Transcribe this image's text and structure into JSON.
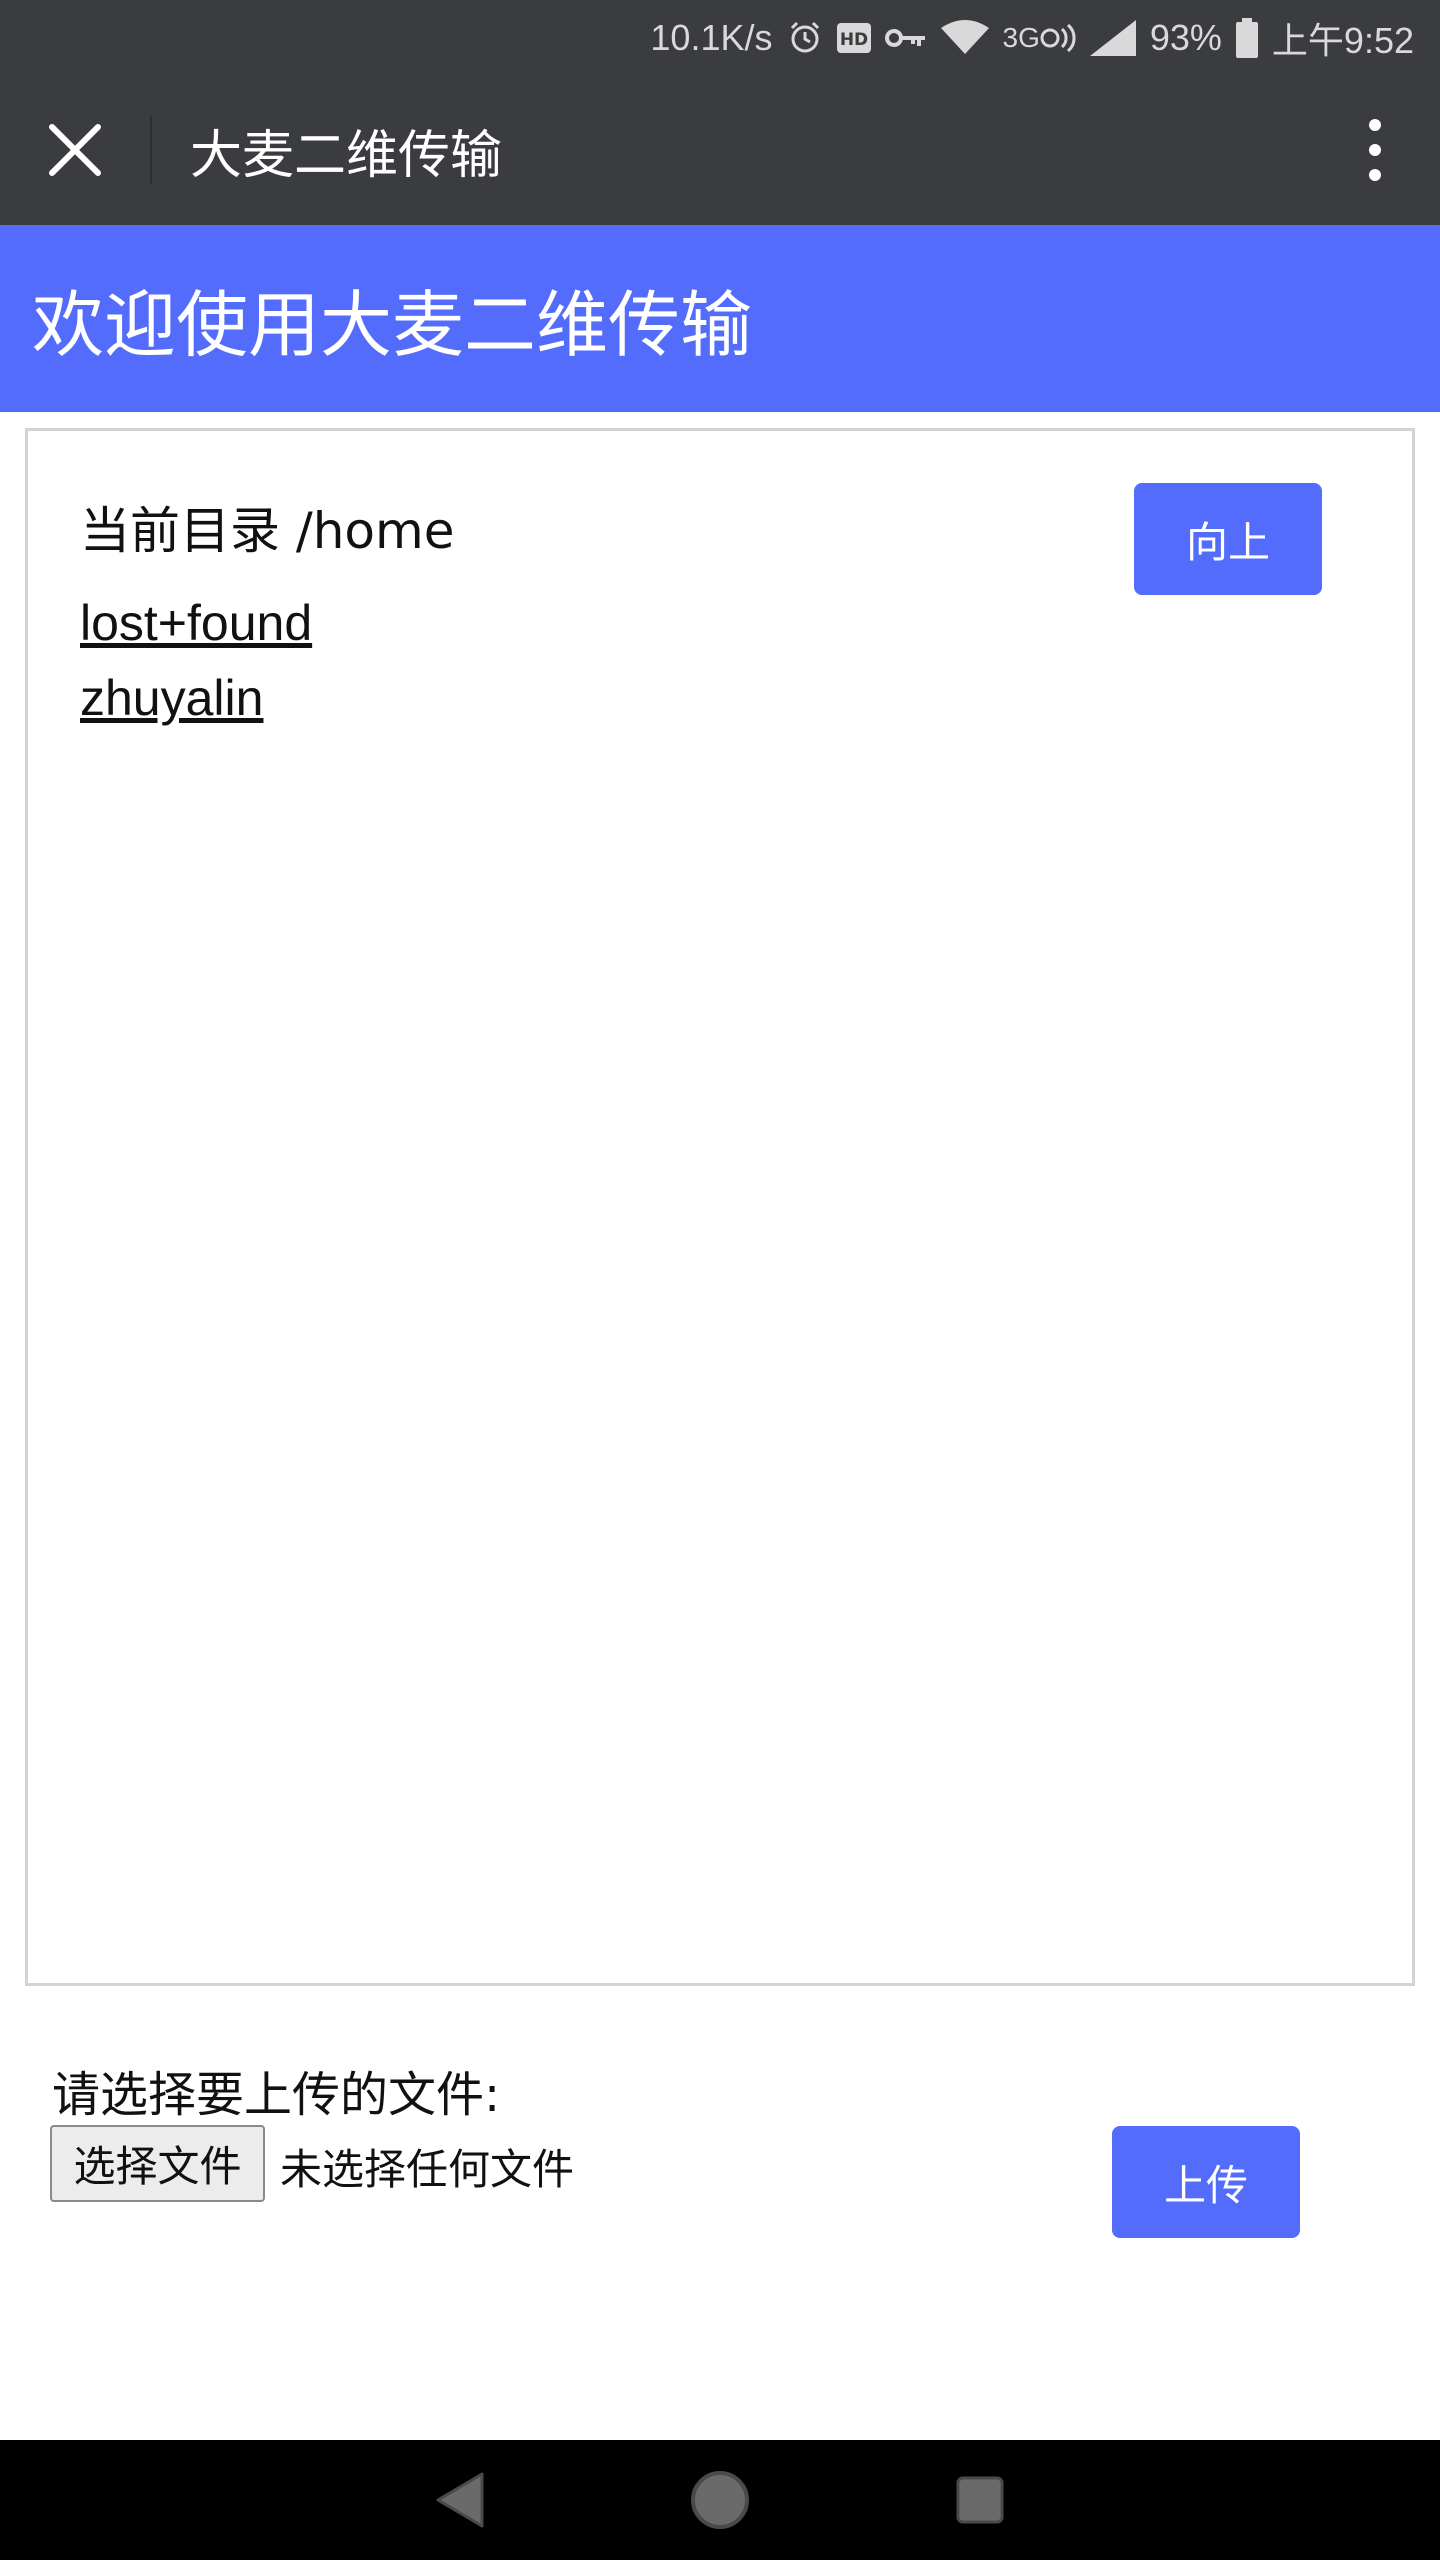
{
  "status_bar": {
    "net_speed": "10.1K/s",
    "network_type": "3G",
    "battery": "93%",
    "time": "上午9:52",
    "icons": [
      "alarm-icon",
      "hd-icon",
      "vpn-key-icon",
      "wifi-icon",
      "network-3g-icon",
      "signal-icon",
      "battery-icon"
    ]
  },
  "title_bar": {
    "title": "大麦二维传输",
    "close_icon": "close-icon",
    "more_icon": "more-vertical-icon"
  },
  "banner": {
    "heading": "欢迎使用大麦二维传输"
  },
  "browser": {
    "current_dir_label": "当前目录 /home",
    "up_button": "向上",
    "entries": [
      {
        "name": "lost+found"
      },
      {
        "name": "zhuyalin"
      }
    ]
  },
  "upload": {
    "prompt": "请选择要上传的文件:",
    "choose_button": "选择文件",
    "no_file_text": "未选择任何文件",
    "upload_button": "上传"
  },
  "nav_bar": {
    "icons": [
      "back-icon",
      "home-icon",
      "recents-icon"
    ]
  },
  "colors": {
    "accent": "#546cfb",
    "title_bar_bg": "#3b3c40",
    "nav_bar_bg": "#000000"
  }
}
